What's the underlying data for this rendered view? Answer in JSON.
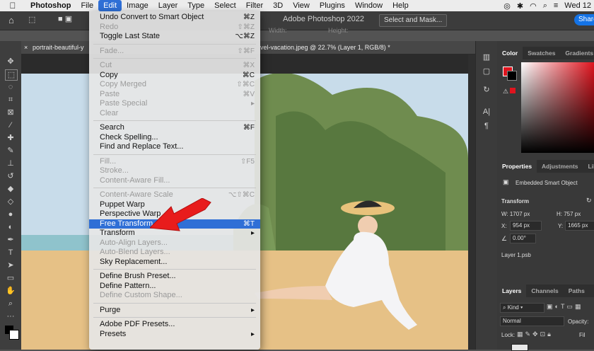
{
  "menubar": {
    "apple": "",
    "items": [
      "Photoshop",
      "File",
      "Edit",
      "Image",
      "Layer",
      "Type",
      "Select",
      "Filter",
      "3D",
      "View",
      "Plugins",
      "Window",
      "Help"
    ],
    "active_index": 2,
    "clock": "Wed 12"
  },
  "app": {
    "title": "Adobe Photoshop 2022",
    "share_label": "Share"
  },
  "options": {
    "width_label": "Width:",
    "height_label": "Height:",
    "select_mask_label": "Select and Mask..."
  },
  "tabs": [
    {
      "label": "portrait-beautiful-y"
    },
    {
      "label": "vel-vacation.jpeg @ 22.7% (Layer 1, RGB/8) *"
    }
  ],
  "edit_menu": {
    "items": [
      {
        "label": "Undo Convert to Smart Object",
        "shortcut": "⌘Z",
        "disabled": false
      },
      {
        "label": "Redo",
        "shortcut": "⇧⌘Z",
        "disabled": true
      },
      {
        "label": "Toggle Last State",
        "shortcut": "⌥⌘Z",
        "disabled": false
      },
      {
        "sep": true
      },
      {
        "label": "Fade...",
        "shortcut": "⇧⌘F",
        "disabled": true
      },
      {
        "sep": true
      },
      {
        "label": "Cut",
        "shortcut": "⌘X",
        "disabled": true
      },
      {
        "label": "Copy",
        "shortcut": "⌘C",
        "disabled": false
      },
      {
        "label": "Copy Merged",
        "shortcut": "⇧⌘C",
        "disabled": true
      },
      {
        "label": "Paste",
        "shortcut": "⌘V",
        "disabled": true
      },
      {
        "label": "Paste Special",
        "shortcut": "▸",
        "disabled": true
      },
      {
        "label": "Clear",
        "shortcut": "",
        "disabled": true
      },
      {
        "sep": true
      },
      {
        "label": "Search",
        "shortcut": "⌘F",
        "disabled": false
      },
      {
        "label": "Check Spelling...",
        "shortcut": "",
        "disabled": false
      },
      {
        "label": "Find and Replace Text...",
        "shortcut": "",
        "disabled": false
      },
      {
        "sep": true
      },
      {
        "label": "Fill...",
        "shortcut": "⇧F5",
        "disabled": true
      },
      {
        "label": "Stroke...",
        "shortcut": "",
        "disabled": true
      },
      {
        "label": "Content-Aware Fill...",
        "shortcut": "",
        "disabled": true
      },
      {
        "sep": true
      },
      {
        "label": "Content-Aware Scale",
        "shortcut": "⌥⇧⌘C",
        "disabled": true
      },
      {
        "label": "Puppet Warp",
        "shortcut": "",
        "disabled": false
      },
      {
        "label": "Perspective Warp",
        "shortcut": "",
        "disabled": false
      },
      {
        "label": "Free Transform",
        "shortcut": "⌘T",
        "disabled": false,
        "highlight": true
      },
      {
        "label": "Transform",
        "shortcut": "▸",
        "disabled": false
      },
      {
        "label": "Auto-Align Layers...",
        "shortcut": "",
        "disabled": true
      },
      {
        "label": "Auto-Blend Layers...",
        "shortcut": "",
        "disabled": true
      },
      {
        "label": "Sky Replacement...",
        "shortcut": "",
        "disabled": false
      },
      {
        "sep": true
      },
      {
        "label": "Define Brush Preset...",
        "shortcut": "",
        "disabled": false
      },
      {
        "label": "Define Pattern...",
        "shortcut": "",
        "disabled": false
      },
      {
        "label": "Define Custom Shape...",
        "shortcut": "",
        "disabled": true
      },
      {
        "sep": true
      },
      {
        "label": "Purge",
        "shortcut": "▸",
        "disabled": false
      },
      {
        "sep": true
      },
      {
        "label": "Adobe PDF Presets...",
        "shortcut": "",
        "disabled": false
      },
      {
        "label": "Presets",
        "shortcut": "▸",
        "disabled": false
      }
    ]
  },
  "color_panel": {
    "tabs": [
      "Color",
      "Swatches",
      "Gradients"
    ],
    "fg": "#e0141e",
    "bg": "#000000"
  },
  "properties_panel": {
    "tabs": [
      "Properties",
      "Adjustments",
      "Libra"
    ],
    "object_type": "Embedded Smart Object",
    "section": "Transform",
    "w": "W: 1707 px",
    "h": "H: 757 px",
    "x_label": "X:",
    "x": "954 px",
    "y_label": "Y:",
    "y": "1665 px",
    "angle": "0.00°",
    "file": "Layer 1.psb"
  },
  "layers_panel": {
    "tabs": [
      "Layers",
      "Channels",
      "Paths"
    ],
    "kind": "Kind",
    "mode": "Normal",
    "opacity_label": "Opacity:",
    "lock_label": "Lock:",
    "fill_label": "Fil"
  }
}
